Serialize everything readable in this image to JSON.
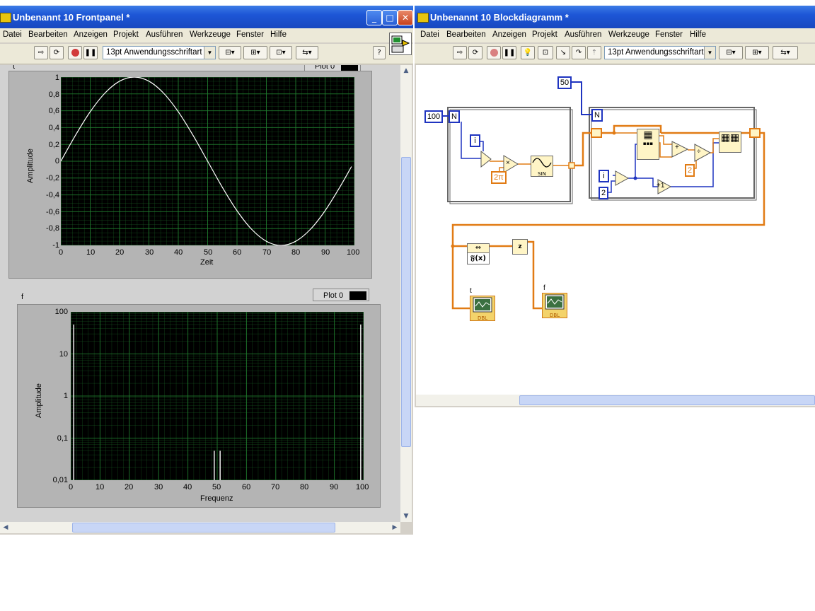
{
  "frontpanel": {
    "title": "Unbenannt 10 Frontpanel *",
    "controls": {
      "minimize": "_",
      "maximize": "□",
      "close": "✕"
    },
    "menu": [
      "Datei",
      "Bearbeiten",
      "Anzeigen",
      "Projekt",
      "Ausführen",
      "Werkzeuge",
      "Fenster",
      "Hilfe"
    ],
    "font_select": "13pt Anwendungsschriftart",
    "help": "?",
    "graph_t": {
      "label": "t",
      "legend": "Plot 0",
      "xlabel": "Zeit",
      "ylabel": "Amplitude",
      "xticks": [
        "0",
        "10",
        "20",
        "30",
        "40",
        "50",
        "60",
        "70",
        "80",
        "90",
        "100"
      ],
      "yticks": [
        "1",
        "0,8",
        "0,6",
        "0,4",
        "0,2",
        "0",
        "-0,2",
        "-0,4",
        "-0,6",
        "-0,8",
        "-1"
      ]
    },
    "graph_f": {
      "label": "f",
      "legend": "Plot 0",
      "xlabel": "Frequenz",
      "ylabel": "Amplitude",
      "xticks": [
        "0",
        "10",
        "20",
        "30",
        "40",
        "50",
        "60",
        "70",
        "80",
        "90",
        "100"
      ],
      "yticks": [
        "100",
        "10",
        "1",
        "0,1",
        "0,01"
      ]
    }
  },
  "blockdiagram": {
    "title": "Unbenannt 10 Blockdiagramm *",
    "controls": {
      "minimize": "_",
      "maximize": "□",
      "close": "✕"
    },
    "menu": [
      "Datei",
      "Bearbeiten",
      "Anzeigen",
      "Projekt",
      "Ausführen",
      "Werkzeuge",
      "Fenster",
      "Hilfe"
    ],
    "font_select": "13pt Anwendungsschriftart",
    "constants": {
      "c100": "100",
      "c50": "50",
      "twopi": "2π",
      "c2a": "2",
      "c2b": "2"
    },
    "loop_counts": {
      "n1": "N",
      "n2": "N"
    },
    "iterators": {
      "i1": "i",
      "i2": "i"
    },
    "nodes": {
      "sin": "SIN",
      "fx": "𝔉(x)",
      "polar": "z",
      "dbl_t": "DBL",
      "dbl_f": "DBL",
      "mult": "×",
      "div": "÷",
      "add": "+",
      "inc": "+1"
    },
    "indicator_labels": {
      "t": "t",
      "f": "f"
    }
  },
  "colors": {
    "titlebar": "#1d56d6",
    "plot_bg": "#000000",
    "grid": "#1f7a2e",
    "trace": "#ffffff",
    "wire_orange": "#e17b14",
    "wire_blue": "#1f34c0"
  },
  "chart_data": [
    {
      "type": "line",
      "name": "t",
      "x": [
        0,
        5,
        10,
        15,
        20,
        25,
        30,
        35,
        40,
        45,
        50,
        55,
        60,
        65,
        70,
        75,
        80,
        85,
        90,
        95,
        99
      ],
      "series": [
        {
          "name": "Plot 0",
          "values": [
            0,
            0.309,
            0.588,
            0.809,
            0.951,
            1,
            0.951,
            0.809,
            0.588,
            0.309,
            0,
            -0.309,
            -0.588,
            -0.809,
            -0.951,
            -1,
            -0.951,
            -0.809,
            -0.588,
            -0.309,
            -0.063
          ]
        }
      ],
      "xlabel": "Zeit",
      "ylabel": "Amplitude",
      "xlim": [
        0,
        100
      ],
      "ylim": [
        -1,
        1
      ],
      "grid": true
    },
    {
      "type": "bar",
      "name": "f",
      "x": [
        1,
        49,
        51,
        99
      ],
      "series": [
        {
          "name": "Plot 0",
          "values": [
            50,
            0.05,
            0.05,
            50
          ]
        }
      ],
      "xlabel": "Frequenz",
      "ylabel": "Amplitude",
      "xlim": [
        0,
        100
      ],
      "ylim": [
        0.01,
        100
      ],
      "yscale": "log",
      "grid": true
    }
  ]
}
